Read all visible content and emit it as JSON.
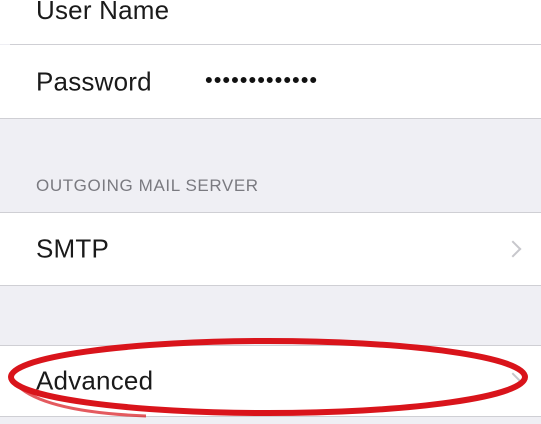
{
  "account": {
    "user_name_label": "User Name",
    "password_label": "Password",
    "password_value": "•••••••••••••"
  },
  "outgoing": {
    "section_title": "OUTGOING MAIL SERVER",
    "smtp_label": "SMTP"
  },
  "advanced": {
    "label": "Advanced"
  },
  "colors": {
    "background": "#efeff4",
    "row": "#ffffff",
    "separator": "#cfcfd4",
    "chevron": "#c7c7cc",
    "highlight": "#d9141b"
  },
  "icons": {
    "disclosure": "chevron-right-icon"
  }
}
